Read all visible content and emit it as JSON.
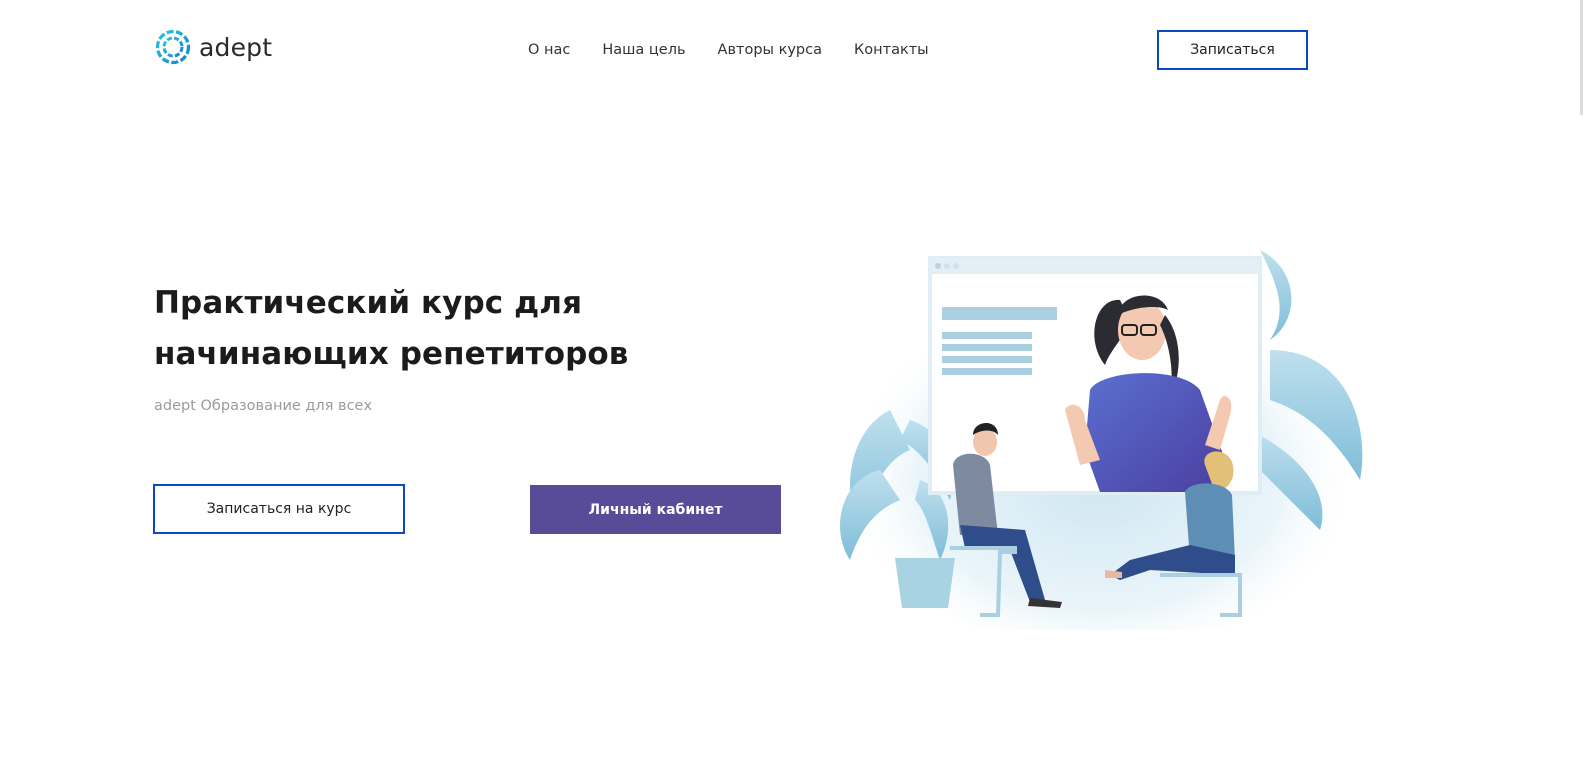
{
  "header": {
    "logo_text": "adept",
    "nav": [
      "О нас",
      "Наша цель",
      "Авторы курса",
      "Контакты"
    ],
    "signup_label": "Записаться"
  },
  "hero": {
    "title": "Практический курс для начинающих репетиторов",
    "subtitle": "adept Образование для всех",
    "course_button": "Записаться на курс",
    "cabinet_button": "Личный кабинет"
  },
  "colors": {
    "accent_blue": "#0b49c1",
    "purple": "#584b98",
    "logo_teal": "#1cb7d6"
  },
  "icons": {
    "logo": "adept-ring-logo-icon"
  }
}
